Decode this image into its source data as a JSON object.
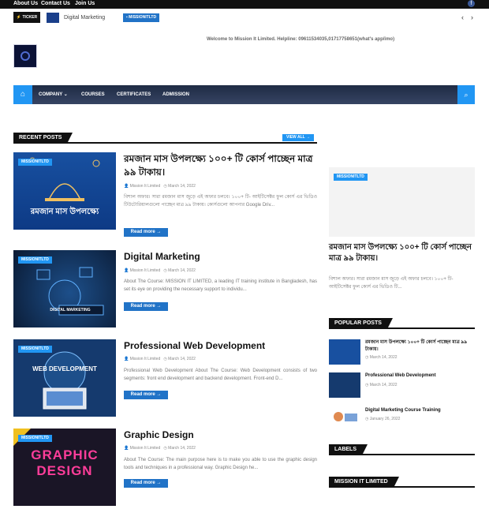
{
  "topbar": {
    "links": [
      "About Us",
      "Contact Us",
      "Join Us"
    ]
  },
  "ticker": {
    "label": "TICKER",
    "headline": "Digital Marketing",
    "badge": "MISSIONITLTD",
    "prev_icon": "arrow-left-icon",
    "next_icon": "arrow-right-icon"
  },
  "header": {
    "welcome": "Welcome to Mission It Limited. Helpline: 09611534035,01717758651(what's app/imo)"
  },
  "nav": {
    "home_icon": "home-icon",
    "items": [
      "COMPANY ⌄",
      "COURSES",
      "CERTIFICATES",
      "ADMISSION"
    ],
    "search_icon": "search-icon"
  },
  "recent": {
    "title": "RECENT POSTS",
    "view_all": "VIEW ALL →",
    "posts": [
      {
        "badge": "MISSIONITLTD",
        "thumb_text": "রমজান মাস উপলক্ষ্যে",
        "title": "রমজান মাস উপলক্ষ্যে ১০০+ টি কোর্স পাচ্ছেন মাত্র ৯৯ টাকায়।",
        "author": "Mission It Limited",
        "date": "March 14, 2022",
        "excerpt": "বিশাল অফার। সারা রমজান মাস জুড়ে এই অফার চলবে। ১০০+ টি- আইটিসেক্টর ফুল কোর্স এর ভিডিও টিউটোরিয়ালগুলো পাচ্ছেন মাত্র ৯৯ টাকায়। কোর্সগুলো আপনার Google Driv...",
        "read_more": "Read more →"
      },
      {
        "badge": "MISSIONITLTD",
        "thumb_text": "DIGITAL MARKETING",
        "title": "Digital Marketing",
        "author": "Mission It Limited",
        "date": "March 14, 2022",
        "excerpt": "About The Course: MISSION IT LIMITED, a leading IT training institute in Bangladesh, has set its eye on providing the necessary support to individu...",
        "read_more": "Read more →"
      },
      {
        "badge": "MISSIONITLTD",
        "thumb_text": "WEB DEVELOPMENT",
        "title": "Professional Web Development",
        "author": "Mission It Limited",
        "date": "March 14, 2022",
        "excerpt": "Professional Web Development About The Course: Web Development consists of two segments: front end development and backend development. Front-end D...",
        "read_more": "Read more →"
      },
      {
        "badge": "MISSIONITLTD",
        "thumb_text": "GRAPHIC DESIGN",
        "title": "Graphic Design",
        "author": "Mission It Limited",
        "date": "March 14, 2022",
        "excerpt": "About The Course: The main purpose here is to make you able to use the graphic design tools and techniques in a professional way. Graphic Design he...",
        "read_more": "Read more →"
      }
    ]
  },
  "featured": {
    "badge": "MISSIONITLTD",
    "title": "রমজান মাস উপলক্ষ্যে ১০০+ টি কোর্স পাচ্ছেন মাত্র ৯৯ টাকায়।",
    "excerpt": "বিশাল অফার। সারা রমজান মাস জুড়ে এই অফার চলবে। ১০০+ টি- আইটিসেক্টর ফুল কোর্স এর ভিডিও টি..."
  },
  "popular": {
    "title": "POPULAR POSTS",
    "items": [
      {
        "title": "রমজান মাস উপলক্ষ্যে ১০০+ টি কোর্স পাচ্ছেন মাত্র ৯৯ টাকায়।",
        "date": "March 14, 2022"
      },
      {
        "title": "Professional Web Development",
        "date": "March 14, 2022"
      },
      {
        "title": "Digital Marketing Course Training",
        "date": "January 26, 2022"
      }
    ]
  },
  "labels": {
    "title": "LABELS"
  },
  "mission": {
    "title": "MISSION IT LIMITED"
  },
  "colors": {
    "accent": "#2196f3",
    "nav_bg": "#2a3654",
    "dark": "#111111"
  }
}
